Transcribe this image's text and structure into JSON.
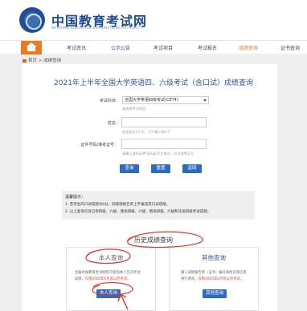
{
  "header": {
    "site_name": "中国教育考试网",
    "site_sub": "NATIONAL EDUCATION EXAMINATIONS AUTHORITY"
  },
  "nav": {
    "items": [
      "考试资讯",
      "公示公告",
      "考试项目",
      "考试报名",
      "成绩查询",
      "证书查询"
    ],
    "active_index": 4
  },
  "breadcrumb": {
    "home": "首页",
    "separator": " > ",
    "current": "成绩查询"
  },
  "main": {
    "title": "2021年上半年全国大学英语四、六级考试（含口试）成绩查询",
    "fields": [
      {
        "label": "考试科目：",
        "value": "全国大学英语四级考试(CET4)",
        "hint": "请选择考试科目"
      },
      {
        "label": "姓名：",
        "value": "",
        "hint": "姓名超过3个字，可只输入前3个"
      },
      {
        "label": "证件号码/准考证号：",
        "value": "",
        "hint": "请输入身份证件号码或15位笔试、口试准考证号"
      }
    ],
    "buttons": [
      "查询",
      "重置",
      "返回"
    ]
  },
  "notes": {
    "title": "温馨提示：",
    "lines": [
      "1. 若考生的口试成绩为0分，则成绩报告单上不报道其口试成绩。",
      "2. 以上查询包含已停四级、六级、德语四级、六级、俄语四级、六级和法语四级考试成绩。"
    ]
  },
  "history": {
    "title": "历史成绩查询",
    "personal": {
      "title": "本人查询",
      "text1": "注册中国教育考试网后可查询本人历次考试",
      "text2_prefix": "成绩，",
      "text2_red": "仅限2005年6月及以后考试。",
      "button": "本人查询"
    },
    "other": {
      "title": "其他查询",
      "text1": "输入成绩报告单（证书）编号和姓名等信息",
      "text2_prefix": "进行查询，",
      "text2_red": "仅限2005年6月及以后考试。",
      "button": "其他查询"
    }
  },
  "colors": {
    "brand_blue": "#2c5790",
    "accent_orange": "#ec7a21",
    "button_blue": "#2e6bc0",
    "annotation_red": "#e0332b"
  }
}
